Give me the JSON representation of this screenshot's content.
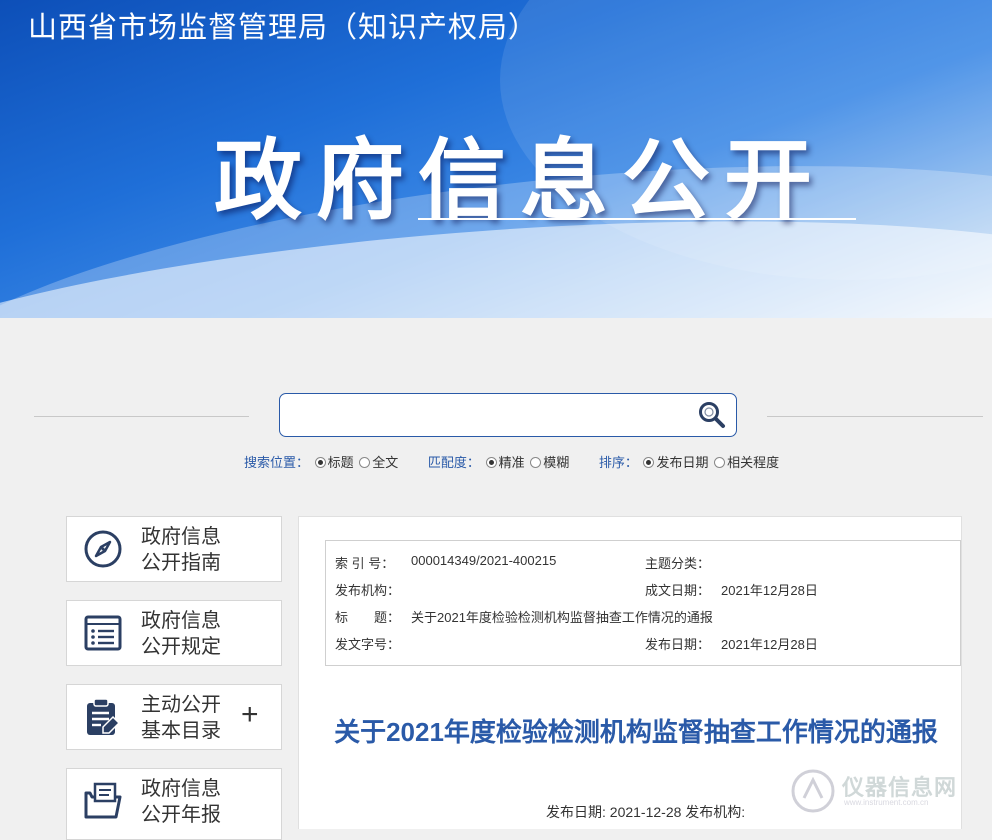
{
  "header": {
    "site_title": "山西省市场监督管理局（知识产权局）",
    "banner_heading": "政府信息公开"
  },
  "search": {
    "value": "",
    "position_label": "搜索位置：",
    "position_options": [
      "标题",
      "全文"
    ],
    "match_label": "匹配度：",
    "match_options": [
      "精准",
      "模糊"
    ],
    "sort_label": "排序：",
    "sort_options": [
      "发布日期",
      "相关程度"
    ]
  },
  "sidebar": {
    "items": [
      {
        "line1": "政府信息",
        "line2": "公开指南",
        "icon": "compass-icon"
      },
      {
        "line1": "政府信息",
        "line2": "公开规定",
        "icon": "list-document-icon"
      },
      {
        "line1": "主动公开",
        "line2": "基本目录",
        "icon": "clipboard-edit-icon",
        "expand": "+"
      },
      {
        "line1": "政府信息",
        "line2": "公开年报",
        "icon": "folder-document-icon"
      }
    ]
  },
  "meta": {
    "index_label": "索 引 号：",
    "index_value": "000014349/2021-400215",
    "topic_label": "主题分类：",
    "topic_value": "",
    "issuer_label": "发布机构：",
    "issuer_value": "",
    "created_label": "成文日期：",
    "created_value": "2021年12月28日",
    "title_label": "标　　题：",
    "title_value": "关于2021年度检验检测机构监督抽查工作情况的通报",
    "docno_label": "发文字号：",
    "docno_value": "",
    "pubdate_label": "发布日期：",
    "pubdate_value": "2021年12月28日"
  },
  "document": {
    "title": "关于2021年度检验检测机构监督抽查工作情况的通报",
    "date_line": "发布日期: 2021-12-28 发布机构:"
  },
  "watermark": {
    "text": "仪器信息网",
    "sub": "www.instrument.com.cn"
  },
  "colors": {
    "accent": "#2a5aa8",
    "banner_blue": "#1f6fd8",
    "icon_navy": "#2b3f63"
  }
}
